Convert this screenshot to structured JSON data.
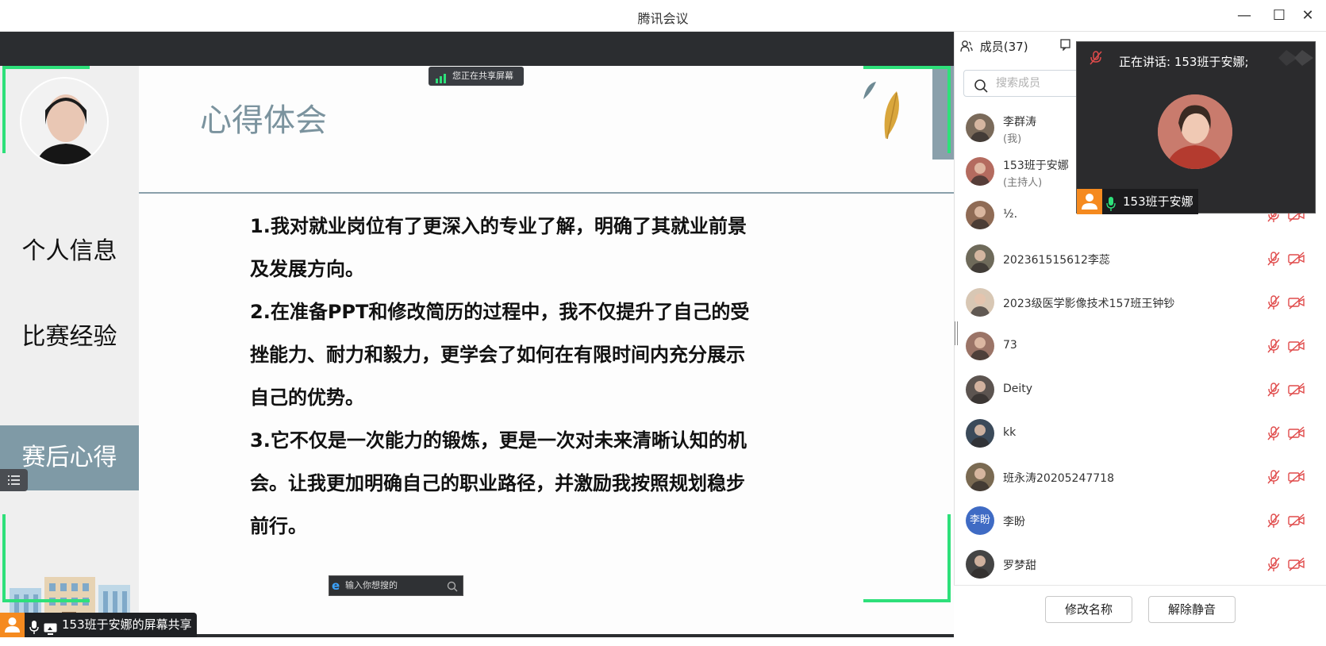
{
  "window": {
    "title": "腾讯会议",
    "controls": {
      "minimize": "—",
      "maximize": "☐",
      "close": "✕"
    }
  },
  "share_indicator": "您正在共享屏幕",
  "slide": {
    "sidebar": {
      "items": [
        {
          "label": "个人信息",
          "active": false
        },
        {
          "label": "比赛经验",
          "active": false
        },
        {
          "label": "赛后心得",
          "active": true
        }
      ]
    },
    "title": "心得体会",
    "lines": [
      "1.我对就业岗位有了更深入的专业了解，明确了其就业前景",
      "及发展方向。",
      "2.在准备PPT和修改简历的过程中，我不仅提升了自己的受",
      "挫能力、耐力和毅力，更学会了如何在有限时间内充分展示",
      "自己的优势。",
      "3.它不仅是一次能力的锻炼，更是一次对未来清晰认知的机",
      "会。让我更加明确自己的职业路径，并激励我按照规划稳步",
      "前行。"
    ]
  },
  "browser_search_placeholder": "输入你想搜的",
  "footer": {
    "share_label": "153班于安娜的屏幕共享"
  },
  "panel": {
    "tab_members": "成员(37)",
    "search_placeholder": "搜索成员",
    "members": [
      {
        "name": "李群涛",
        "sub": "(我)",
        "color": "#7a6a5a"
      },
      {
        "name": "153班于安娜",
        "sub": "(主持人)",
        "color": "#b46b5f"
      },
      {
        "name": "½.",
        "sub": "",
        "color": "#8f6b55"
      },
      {
        "name": "202361515612李蕊",
        "sub": "",
        "color": "#6e6a5a"
      },
      {
        "name": "2023级医学影像技术157班王钟钞",
        "sub": "",
        "color": "#d8c7b4"
      },
      {
        "name": "73",
        "sub": "",
        "color": "#9b7467"
      },
      {
        "name": "Deity",
        "sub": "",
        "color": "#5c5450"
      },
      {
        "name": "kk",
        "sub": "",
        "color": "#3b4a5a"
      },
      {
        "name": "班永涛20205247718",
        "sub": "",
        "color": "#7a6a52"
      },
      {
        "name": "李盼",
        "sub": "",
        "color": "#3f6bc4",
        "initials": "李盼"
      },
      {
        "name": "罗梦甜",
        "sub": "",
        "color": "#444"
      }
    ],
    "buttons": {
      "rename": "修改名称",
      "unmute": "解除静音"
    }
  },
  "speaker": {
    "title": "正在讲话:  153班于安娜;",
    "name": "153班于安娜"
  },
  "colors": {
    "accent_green": "#2ee07a",
    "slide_accent": "#7f9aa6",
    "mute_red": "#e04b4b",
    "orange": "#f58a1f"
  }
}
